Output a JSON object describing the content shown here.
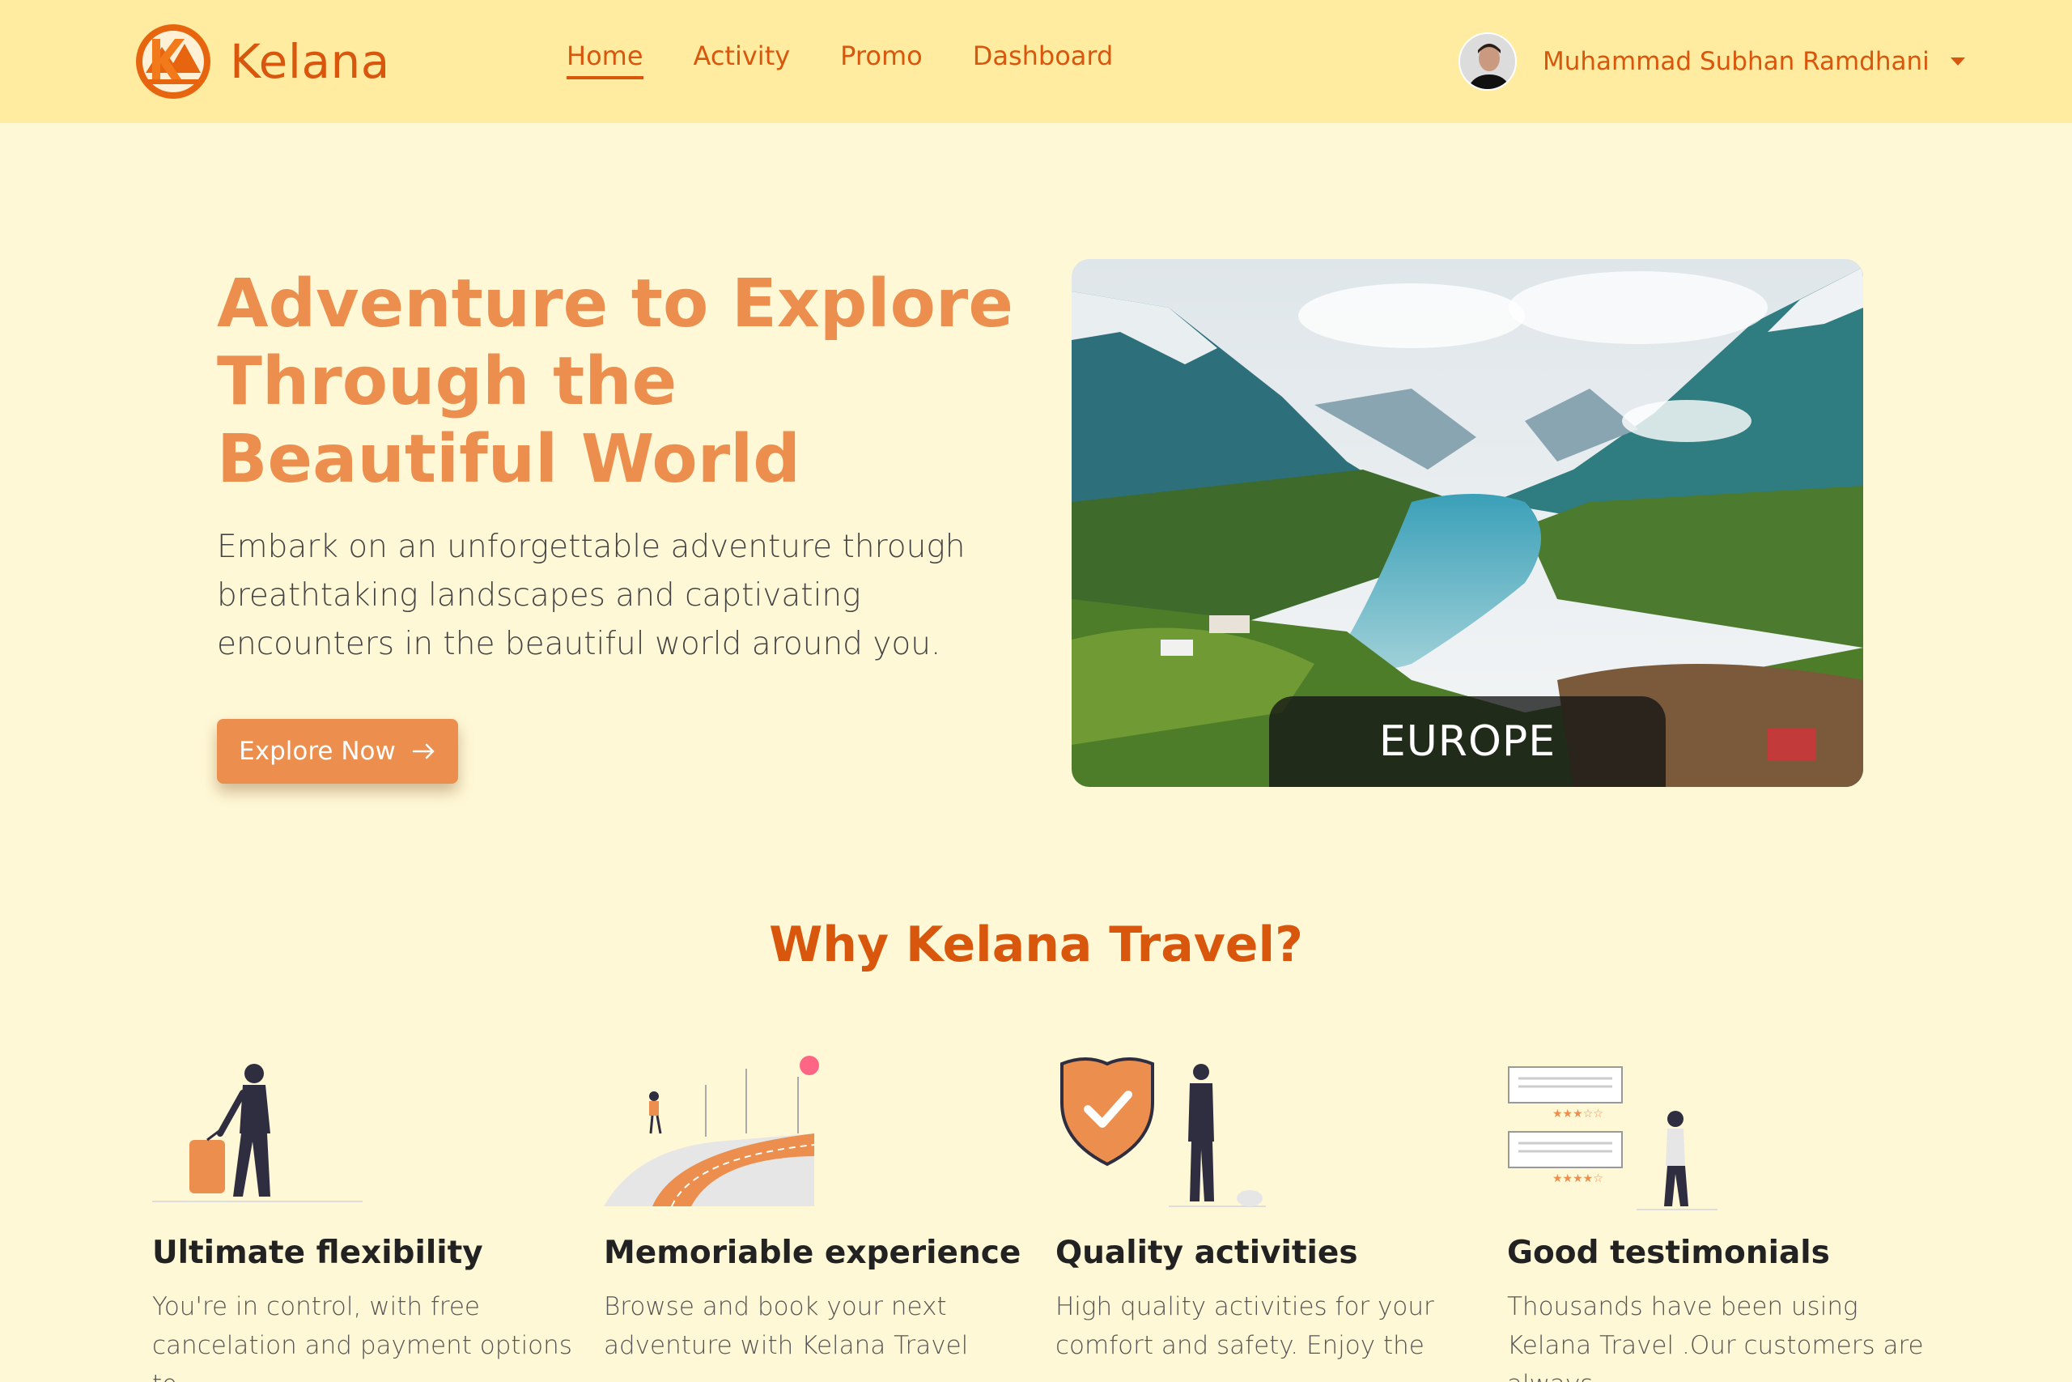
{
  "brand": {
    "name": "Kelana"
  },
  "nav": {
    "items": [
      {
        "label": "Home",
        "active": true
      },
      {
        "label": "Activity",
        "active": false
      },
      {
        "label": "Promo",
        "active": false
      },
      {
        "label": "Dashboard",
        "active": false
      }
    ]
  },
  "user": {
    "name": "Muhammad Subhan Ramdhani"
  },
  "hero": {
    "title": "Adventure to Explore Through the Beautiful World",
    "description": "Embark on an unforgettable adventure through breathtaking landscapes and captivating encounters in the beautiful world around you.",
    "cta_label": "Explore Now",
    "image_label": "EUROPE"
  },
  "why": {
    "title": "Why Kelana Travel?",
    "features": [
      {
        "title": "Ultimate flexibility",
        "desc": "You're in control, with free cancelation and payment options to"
      },
      {
        "title": "Memoriable experience",
        "desc": "Browse and book your next adventure with Kelana Travel"
      },
      {
        "title": "Quality activities",
        "desc": "High quality activities for your comfort and safety. Enjoy the"
      },
      {
        "title": "Good testimonials",
        "desc": "Thousands have been using Kelana Travel .Our customers are always"
      }
    ]
  },
  "colors": {
    "accent": "#ec8f4e",
    "brand": "#d9560d",
    "nav_bg": "#ffeca0",
    "page_bg": "#fff8d6"
  }
}
